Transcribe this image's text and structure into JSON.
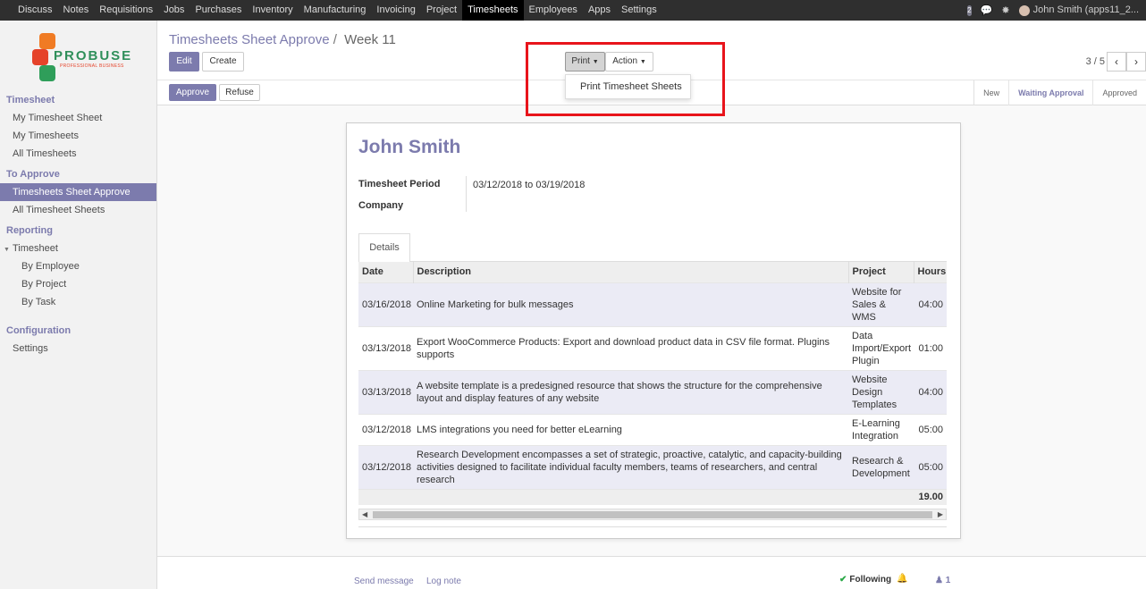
{
  "topnav": {
    "items": [
      "Discuss",
      "Notes",
      "Requisitions",
      "Jobs",
      "Purchases",
      "Inventory",
      "Manufacturing",
      "Invoicing",
      "Project",
      "Timesheets",
      "Employees",
      "Apps",
      "Settings"
    ],
    "active_index": 9,
    "message_count": "2",
    "user": "John Smith (apps11_2..."
  },
  "logo": {
    "word": "PROBUSE",
    "tagline": "PROFESSIONAL BUSINESS"
  },
  "sidebar": {
    "section1": "Timesheet",
    "item1": "My Timesheet Sheet",
    "item2": "My Timesheets",
    "item3": "All Timesheets",
    "section2": "To Approve",
    "item4": "Timesheets Sheet Approve",
    "item5": "All Timesheet Sheets",
    "section3": "Reporting",
    "group1": "Timesheet",
    "item6": "By Employee",
    "item7": "By Project",
    "item8": "By Task",
    "section4": "Configuration",
    "item9": "Settings"
  },
  "control": {
    "breadcrumb_parent": "Timesheets Sheet Approve",
    "breadcrumb_sep": "/",
    "breadcrumb_current": "Week 11",
    "edit_label": "Edit",
    "create_label": "Create",
    "print_label": "Print",
    "action_label": "Action",
    "dropdown_item": "Print Timesheet Sheets",
    "pager": "3 / 5",
    "approve_label": "Approve",
    "refuse_label": "Refuse",
    "status": [
      "New",
      "Waiting Approval",
      "Approved"
    ]
  },
  "sheet": {
    "employee": "John Smith",
    "period_label": "Timesheet Period",
    "period_value": "03/12/2018 to 03/19/2018",
    "company_label": "Company",
    "tab_label": "Details",
    "columns": [
      "Date",
      "Description",
      "Project",
      "Hours"
    ],
    "rows": [
      {
        "date": "03/16/2018",
        "desc": "Online Marketing for bulk messages",
        "project": "Website for Sales & WMS",
        "hours": "04:00"
      },
      {
        "date": "03/13/2018",
        "desc": "Export WooCommerce Products: Export and download product data in CSV file format. Plugins supports",
        "project": "Data Import/Export Plugin",
        "hours": "01:00"
      },
      {
        "date": "03/13/2018",
        "desc": "A website template is a predesigned resource that shows the structure for the comprehensive layout and display features of any website",
        "project": "Website Design Templates",
        "hours": "04:00"
      },
      {
        "date": "03/12/2018",
        "desc": "LMS integrations you need for better eLearning",
        "project": "E-Learning Integration",
        "hours": "05:00"
      },
      {
        "date": "03/12/2018",
        "desc": "Research Development encompasses a set of strategic, proactive, catalytic, and capacity-building activities designed to facilitate individual faculty members, teams of researchers, and central research",
        "project": "Research & Development",
        "hours": "05:00"
      }
    ],
    "total_hours": "19.00"
  },
  "chatter": {
    "send_message": "Send message",
    "log_note": "Log note",
    "following": "Following",
    "followers": "1"
  }
}
